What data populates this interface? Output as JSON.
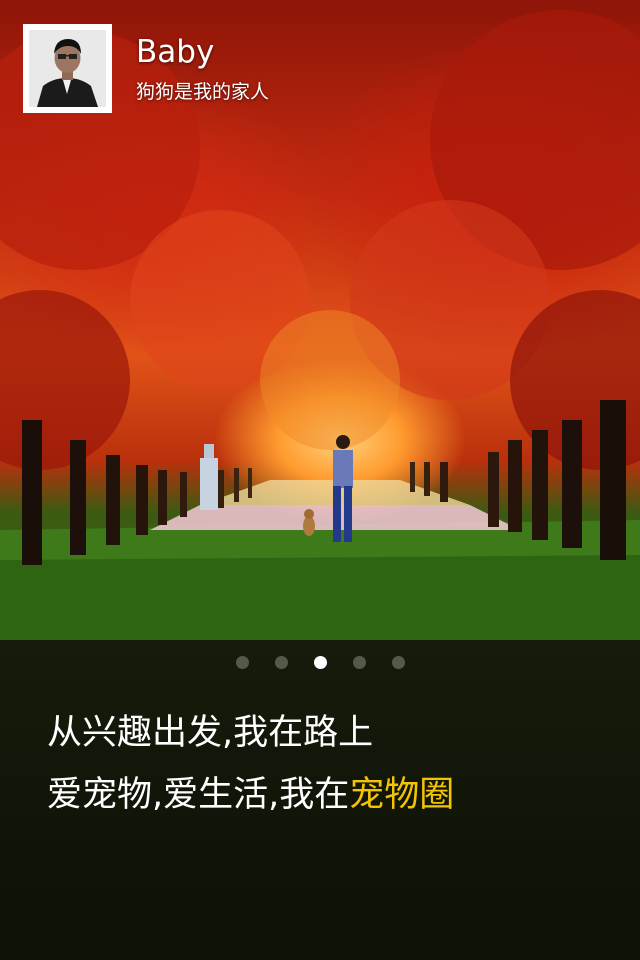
{
  "profile": {
    "name": "Baby",
    "signature": "狗狗是我的家人"
  },
  "pager": {
    "total": 5,
    "active_index": 2
  },
  "slogan": {
    "line1": "从兴趣出发,我在路上",
    "line2_prefix": "爱宠物,爱生活,我在",
    "line2_highlight": "宠物圈"
  },
  "colors": {
    "highlight": "#f5c400",
    "panel_bg": "#131909",
    "dot_inactive": "#55594c",
    "dot_active": "#ffffff"
  }
}
